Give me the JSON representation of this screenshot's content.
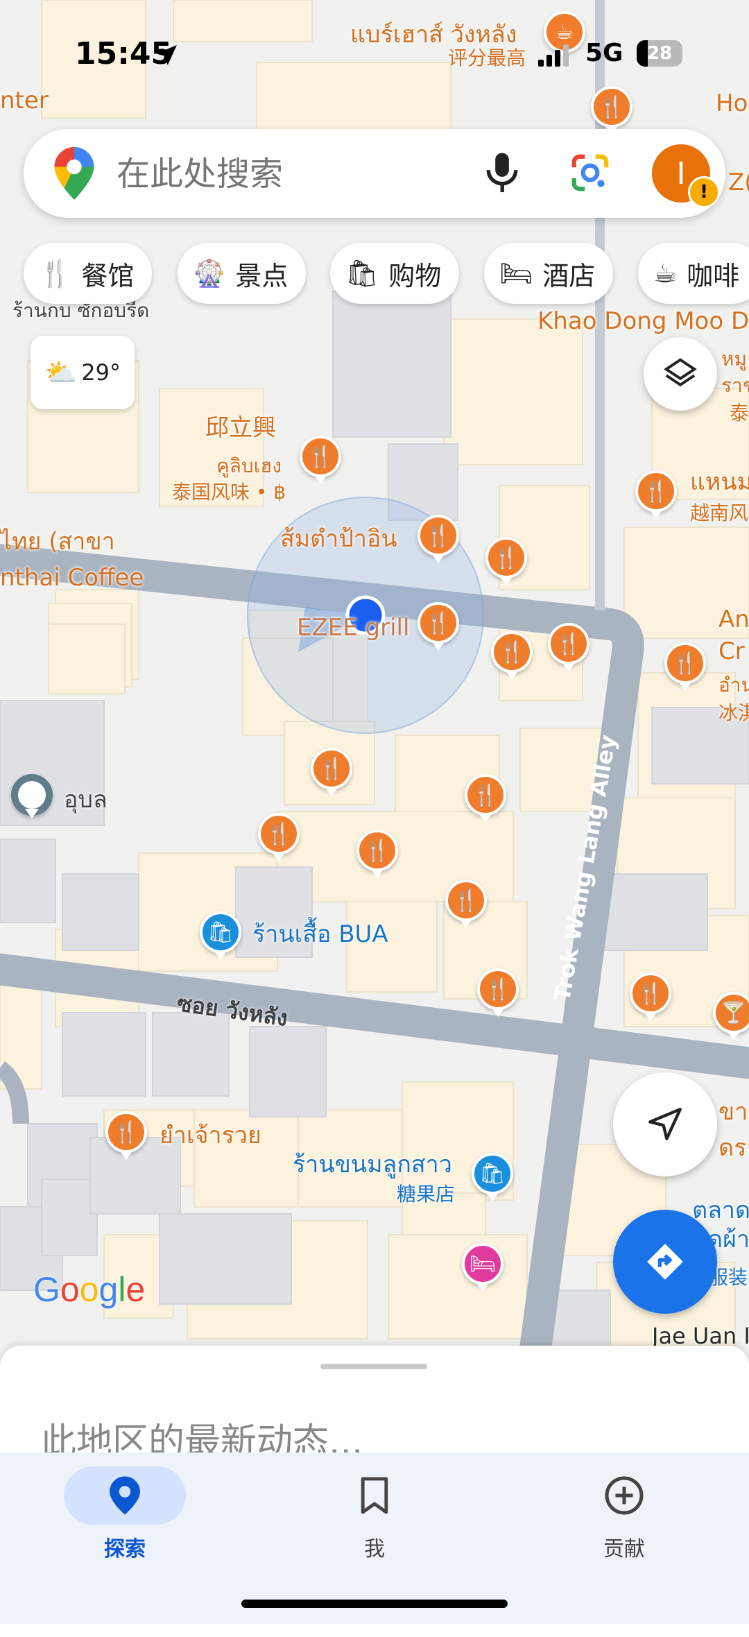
{
  "status_bar": {
    "time": "15:45",
    "network": "5G",
    "battery": "28",
    "overlay_place": "แบร์เฮาส์ วังหลัง",
    "overlay_rating": "评分最高"
  },
  "search": {
    "placeholder": "在此处搜索",
    "avatar_letter": "I"
  },
  "chips": [
    {
      "label": "餐馆",
      "icon": "restaurant-icon"
    },
    {
      "label": "景点",
      "icon": "attraction-icon"
    },
    {
      "label": "购物",
      "icon": "shopping-bag-icon"
    },
    {
      "label": "酒店",
      "icon": "hotel-bed-icon"
    },
    {
      "label": "咖啡",
      "icon": "coffee-cup-icon"
    }
  ],
  "weather": {
    "temp": "29°",
    "icon": "partly-cloudy-icon"
  },
  "map_labels": {
    "center_left": "nter",
    "ho": "Ho",
    "zo": "Z(",
    "khaodong": "Khao Dong Moo D",
    "ranklob": "ร้านกบ ซักอบรีด",
    "qiu_cn": "邱立興",
    "qiu_th": "คูลิบเฮง",
    "qiu_sub": "泰国风味 • ฿",
    "somtam": "ส้มตำป้าอิน",
    "thai_sakha": "ไทย (สาขา",
    "inthai": "nthai Coffee",
    "ezee": "EZEE grill",
    "hanum": "แหนม",
    "yuenan": "越南风",
    "right_mu": "หมู",
    "right_rawa": "ราช",
    "right_tai": "泰",
    "an": "An",
    "cr": "Cr",
    "ampu": "อำน",
    "bing": "冰淇",
    "alley": "Trok Wang Lang Alley",
    "ubon": "อุบล",
    "bua": "ร้านเสื้อ BUA",
    "soi": "ซอย วังหลัง",
    "yamjeruay": "ยำเจ้ารวย",
    "khanom_th": "ร้านขนมลูกสาว",
    "khanom_cn": "糖果店",
    "khao_right": "ขาย",
    "drl": "ดรล",
    "talad": "ตลาดวัง",
    "kapha": "ดผ้า",
    "fuzhuang": "服装",
    "jaeuan": "Jae Uan I",
    "google": "Google"
  },
  "sheet": {
    "title": "此地区的最新动态..."
  },
  "bottom_nav": [
    {
      "label": "探索",
      "icon": "location-pin-icon",
      "active": true
    },
    {
      "label": "我",
      "icon": "bookmark-icon",
      "active": false
    },
    {
      "label": "贡献",
      "icon": "add-circle-icon",
      "active": false
    }
  ],
  "colors": {
    "accent": "#0b57d0",
    "poi_orange": "#ef7d2b",
    "fab_blue": "#1a73e8"
  }
}
